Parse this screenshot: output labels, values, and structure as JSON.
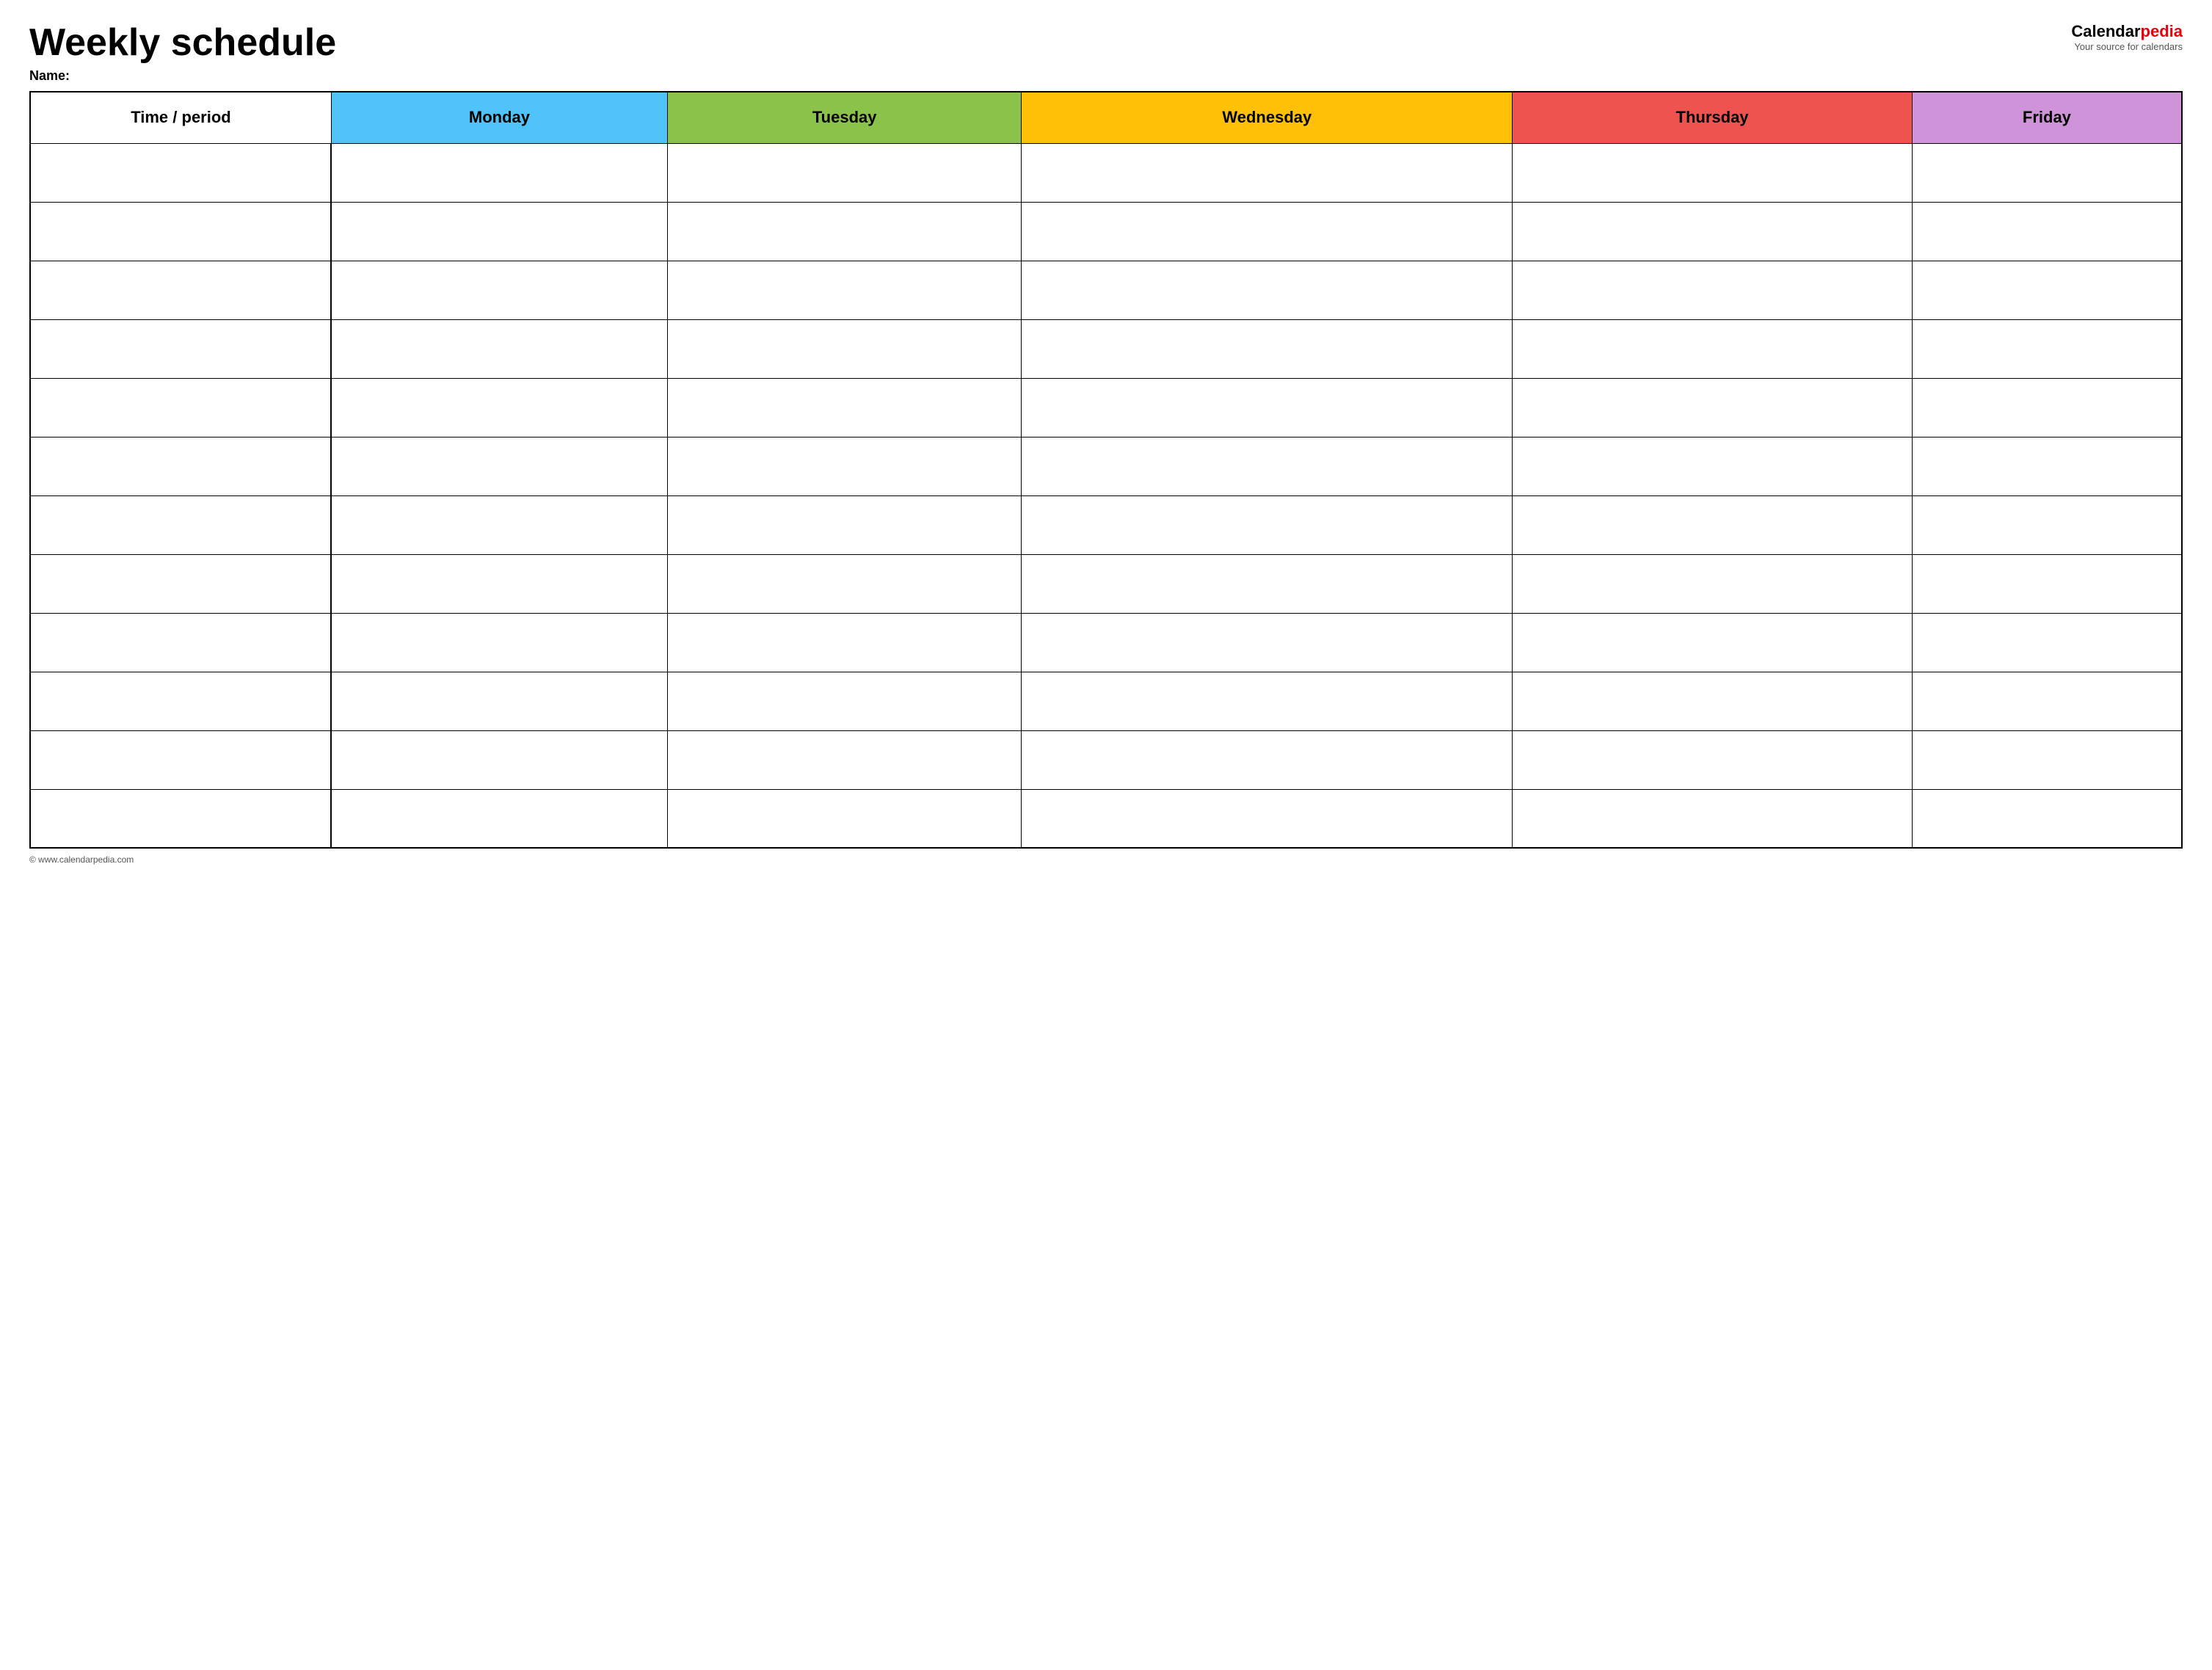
{
  "header": {
    "title": "Weekly schedule",
    "name_label": "Name:",
    "logo": {
      "calendar_part": "Calendar",
      "pedia_part": "pedia",
      "subtitle": "Your source for calendars"
    }
  },
  "table": {
    "columns": [
      {
        "key": "time",
        "label": "Time / period",
        "color": "#ffffff",
        "class": "col-time"
      },
      {
        "key": "monday",
        "label": "Monday",
        "color": "#4fc3f7",
        "class": "col-monday"
      },
      {
        "key": "tuesday",
        "label": "Tuesday",
        "color": "#8bc34a",
        "class": "col-tuesday"
      },
      {
        "key": "wednesday",
        "label": "Wednesday",
        "color": "#ffc107",
        "class": "col-wednesday"
      },
      {
        "key": "thursday",
        "label": "Thursday",
        "color": "#ef5350",
        "class": "col-thursday"
      },
      {
        "key": "friday",
        "label": "Friday",
        "color": "#ce93d8",
        "class": "col-friday"
      }
    ],
    "row_count": 12
  },
  "footer": {
    "text": "© www.calendarpedia.com"
  }
}
